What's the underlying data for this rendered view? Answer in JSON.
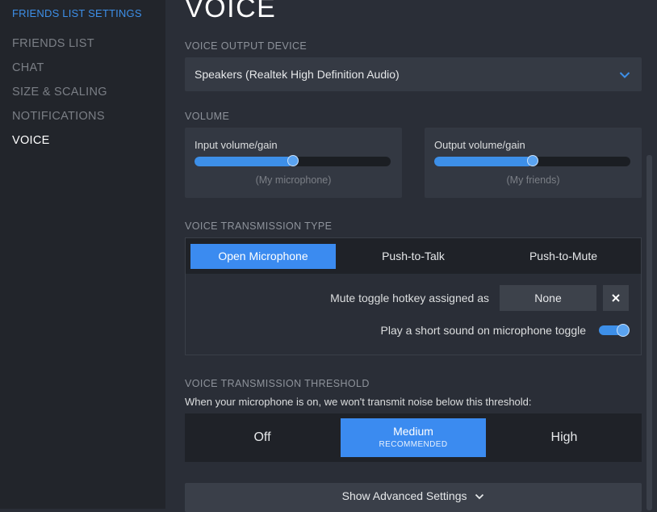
{
  "sidebar": {
    "title": "FRIENDS LIST SETTINGS",
    "items": [
      {
        "label": "FRIENDS LIST",
        "active": false
      },
      {
        "label": "CHAT",
        "active": false
      },
      {
        "label": "SIZE & SCALING",
        "active": false
      },
      {
        "label": "NOTIFICATIONS",
        "active": false
      },
      {
        "label": "VOICE",
        "active": true
      }
    ]
  },
  "page": {
    "title": "VOICE"
  },
  "output_device": {
    "label": "VOICE OUTPUT DEVICE",
    "value": "Speakers (Realtek High Definition Audio)",
    "icon": "chevron-down-icon"
  },
  "volume": {
    "label": "VOLUME",
    "input": {
      "label": "Input volume/gain",
      "sublabel": "(My microphone)",
      "level": 0.5
    },
    "output": {
      "label": "Output volume/gain",
      "sublabel": "(My friends)",
      "level": 0.5
    }
  },
  "transmission": {
    "label": "VOICE TRANSMISSION TYPE",
    "tabs": [
      "Open Microphone",
      "Push-to-Talk",
      "Push-to-Mute"
    ],
    "selected": "Open Microphone",
    "hotkey_label": "Mute toggle hotkey assigned as",
    "hotkey_value": "None",
    "clear_icon": "close-icon",
    "sound_label": "Play a short sound on microphone toggle",
    "sound_enabled": true
  },
  "threshold": {
    "label": "VOICE TRANSMISSION THRESHOLD",
    "description": "When your microphone is on, we won't transmit noise below this threshold:",
    "options": [
      "Off",
      "Medium",
      "High"
    ],
    "recommended_tag": "RECOMMENDED",
    "selected": "Medium"
  },
  "advanced": {
    "label": "Show Advanced Settings",
    "icon": "chevron-down-icon"
  },
  "colors": {
    "accent": "#3b8bf0",
    "background": "#2a2e37",
    "sidebar": "#22252b"
  }
}
